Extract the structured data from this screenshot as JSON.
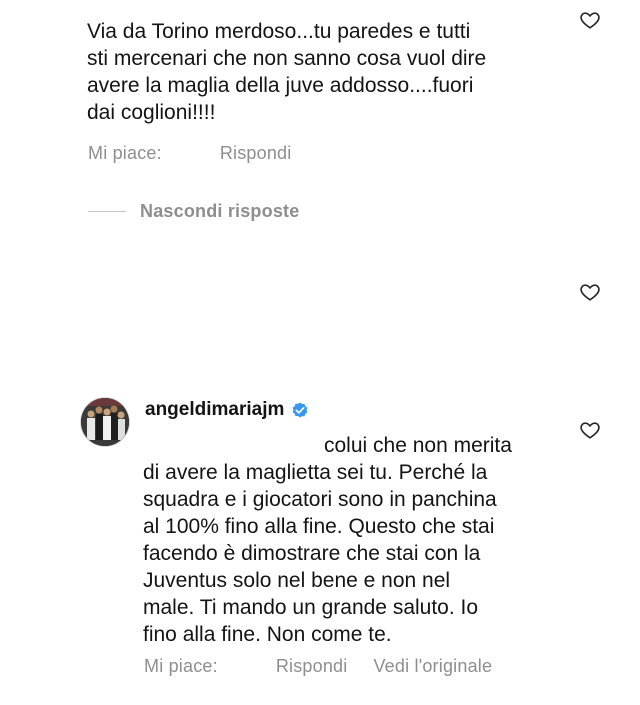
{
  "comment1": {
    "text": "Via da Torino merdoso...tu paredes e tutti\nsti mercenari che non sanno cosa vuol dire\navere la maglia della juve addosso....fuori\ndai coglioni!!!!",
    "like_label": "Mi piace:",
    "reply_label": "Rispondi"
  },
  "replies_toggle": {
    "label": "Nascondi risposte"
  },
  "reply": {
    "username": "angeldimariajm",
    "text": "colui che non merita\ndi avere la maglietta sei tu. Perché la\nsquadra e i giocatori sono in panchina\nal 100% fino alla fine. Questo che stai\nfacendo è dimostrare che stai con la\nJuventus solo nel bene e non nel\nmale. Ti mando un grande saluto. Io\nfino alla fine. Non come te.",
    "like_label": "Mi piace:",
    "reply_label": "Rispondi",
    "translate_label": "Vedi l'originale"
  },
  "colors": {
    "text": "#141414",
    "secondary": "#8e8e8e",
    "verified": "#3897f0",
    "divider": "#c7c7c7"
  },
  "icons": {
    "like": "heart-icon",
    "verified": "verified-badge-icon"
  }
}
